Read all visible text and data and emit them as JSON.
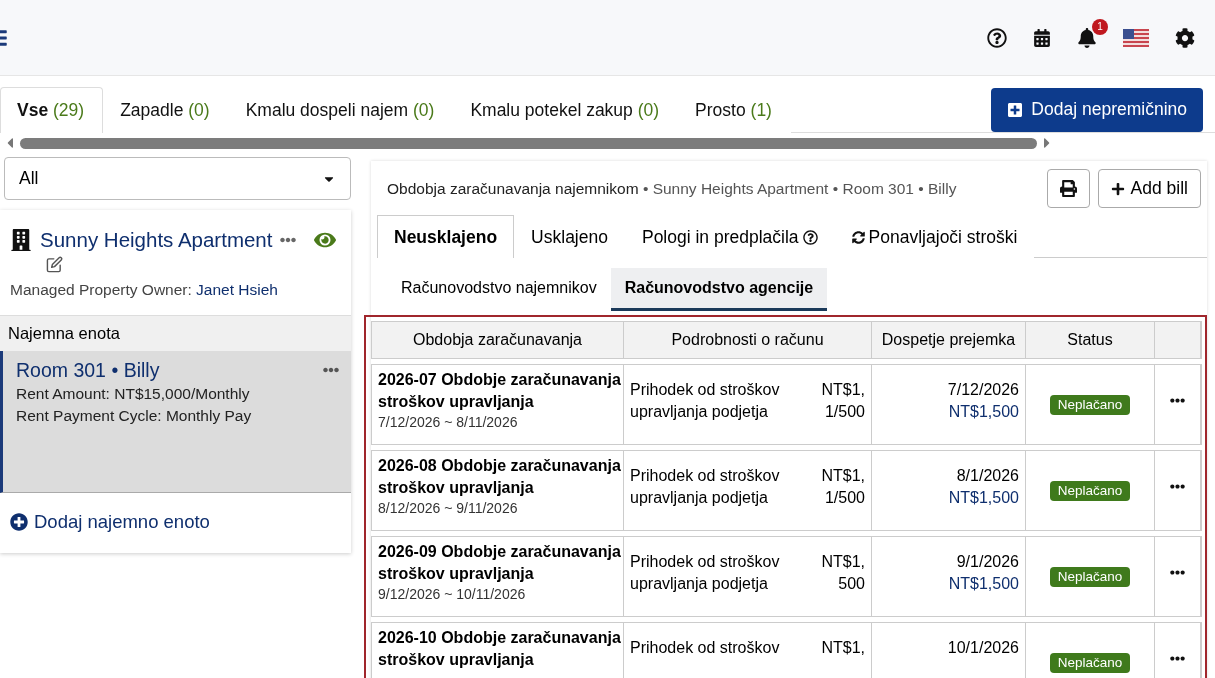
{
  "header": {
    "notifications": "1"
  },
  "tabs": [
    {
      "label": "Vse",
      "count": "(29)",
      "selected": true
    },
    {
      "label": "Zapadle",
      "count": "(0)",
      "selected": false
    },
    {
      "label": "Kmalu dospeli najem",
      "count": "(0)",
      "selected": false
    },
    {
      "label": "Kmalu potekel zakup",
      "count": "(0)",
      "selected": false
    },
    {
      "label": "Prosto",
      "count": "(1)",
      "selected": false
    }
  ],
  "add_property_button": "Dodaj nepremičnino",
  "filter": {
    "value": "All"
  },
  "property": {
    "name": "Sunny Heights Apartment",
    "owner_label": "Managed Property Owner:",
    "owner": "Janet Hsieh",
    "visible": true
  },
  "units_heading": "Najemna enota",
  "units": [
    {
      "room": "Room 301",
      "separator": "•",
      "tenant": "Billy",
      "rent": "Rent Amount: NT$15,000/Monthly",
      "cycle": "Rent Payment Cycle: Monthly Pay",
      "selected": true
    }
  ],
  "add_unit": "Dodaj najemno enoto",
  "breadcrumb": {
    "title": "Obdobja zaračunavanja najemnikom",
    "separator": "•",
    "path": [
      "Sunny Heights Apartment",
      "Room 301",
      "Billy"
    ]
  },
  "add_bill": "Add bill",
  "bill_tabs": [
    {
      "label": "Neusklajeno",
      "selected": true,
      "kind": "plain"
    },
    {
      "label": "Usklajeno",
      "selected": false,
      "kind": "plain"
    },
    {
      "label": "Pologi in predplačila",
      "selected": false,
      "kind": "help"
    },
    {
      "label": "Ponavljajoči stroški",
      "selected": false,
      "kind": "recurring"
    }
  ],
  "sub_tabs": [
    {
      "label": "Računovodstvo najemnikov",
      "selected": false
    },
    {
      "label": "Računovodstvo agencije",
      "selected": true
    }
  ],
  "table": {
    "columns": [
      "Obdobja zaračunavanja",
      "Podrobnosti o računu",
      "Dospetje prejemka",
      "Status"
    ],
    "rows": [
      {
        "title": [
          "2026-07 Obdobje zaračunavanja",
          "stroškov upravljanja"
        ],
        "range": "7/12/2026 ~ 8/11/2026",
        "details": [
          "Prihodek od stroškov",
          "upravljanja podjetja"
        ],
        "amount": [
          "NT$1,",
          "1/500"
        ],
        "due": [
          "7/12/2026",
          "NT$1,500"
        ],
        "status": "Neplačano"
      },
      {
        "title": [
          "2026-08 Obdobje zaračunavanja",
          "stroškov upravljanja"
        ],
        "range": "8/12/2026 ~ 9/11/2026",
        "details": [
          "Prihodek od stroškov",
          "upravljanja podjetja"
        ],
        "amount": [
          "NT$1,",
          "1/500"
        ],
        "due": [
          "8/1/2026",
          "NT$1,500"
        ],
        "status": "Neplačano"
      },
      {
        "title": [
          "2026-09 Obdobje zaračunavanja",
          "stroškov upravljanja"
        ],
        "range": "9/12/2026 ~ 10/11/2026",
        "details": [
          "Prihodek od stroškov",
          "upravljanja podjetja"
        ],
        "amount": [
          "NT$1,",
          "500"
        ],
        "due": [
          "9/1/2026",
          "NT$1,500"
        ],
        "status": "Neplačano"
      },
      {
        "title": [
          "2026-10 Obdobje zaračunavanja",
          "stroškov upravljanja"
        ],
        "details": [
          "Prihodek od stroškov"
        ],
        "amount": [
          "NT$1,"
        ],
        "due": [
          "10/1/2026"
        ],
        "status": "Neplačano"
      }
    ]
  }
}
